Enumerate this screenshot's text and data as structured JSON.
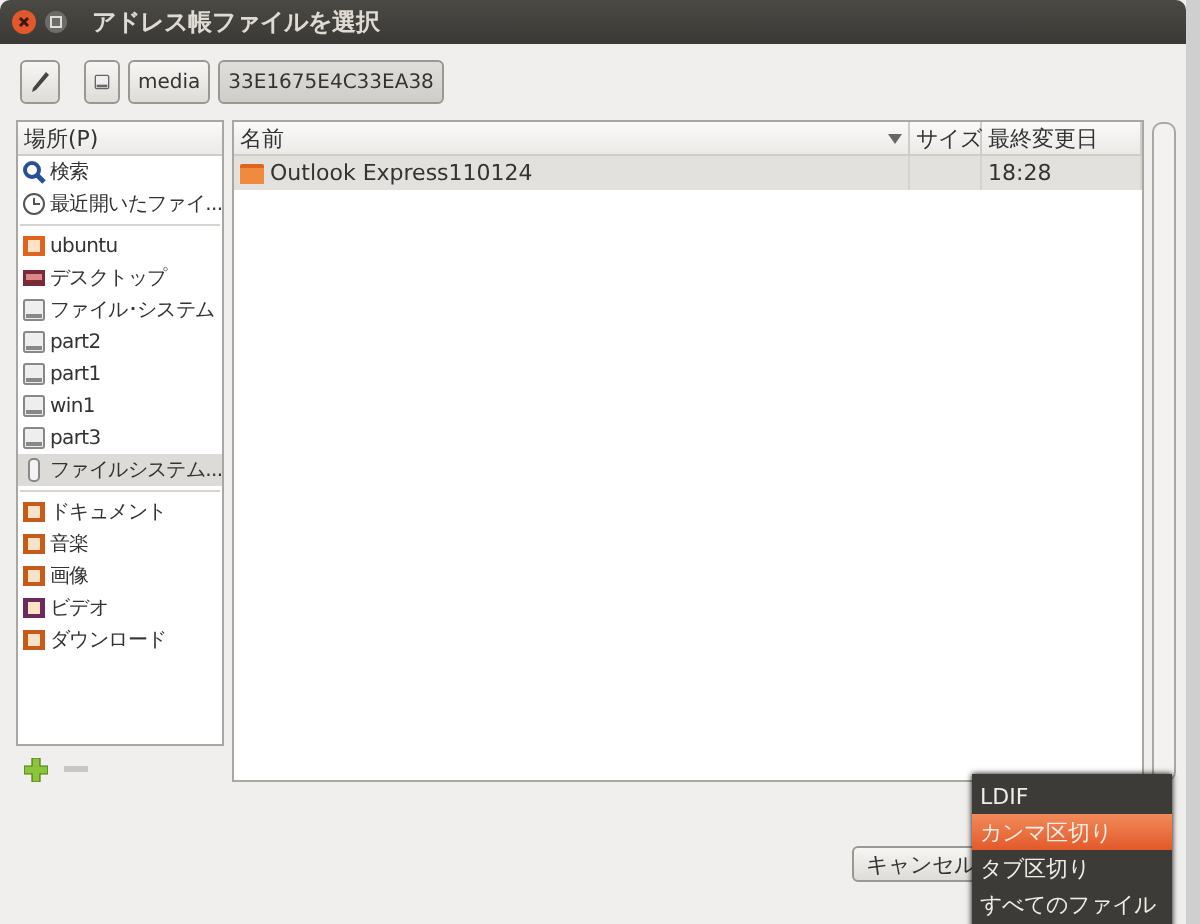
{
  "window": {
    "title": "アドレス帳ファイルを選択"
  },
  "path_bar": {
    "segments": [
      {
        "label": "media",
        "selected": false
      },
      {
        "label": "33E1675E4C33EA38",
        "selected": true
      }
    ]
  },
  "places": {
    "header": "場所(P)",
    "groups": [
      [
        {
          "kind": "search",
          "label": "検索",
          "selected": false
        },
        {
          "kind": "recent",
          "label": "最近開いたファイ...",
          "selected": false
        }
      ],
      [
        {
          "kind": "home",
          "label": "ubuntu",
          "selected": false
        },
        {
          "kind": "desktop",
          "label": "デスクトップ",
          "selected": false
        },
        {
          "kind": "drive",
          "label": "ファイル･システム",
          "selected": false
        },
        {
          "kind": "drive",
          "label": "part2",
          "selected": false
        },
        {
          "kind": "drive",
          "label": "part1",
          "selected": false
        },
        {
          "kind": "drive",
          "label": "win1",
          "selected": false
        },
        {
          "kind": "drive",
          "label": "part3",
          "selected": false
        },
        {
          "kind": "usb",
          "label": "ファイルシステム...",
          "selected": true
        }
      ],
      [
        {
          "kind": "documents",
          "label": "ドキュメント",
          "selected": false
        },
        {
          "kind": "music",
          "label": "音楽",
          "selected": false
        },
        {
          "kind": "pictures",
          "label": "画像",
          "selected": false
        },
        {
          "kind": "video",
          "label": "ビデオ",
          "selected": false
        },
        {
          "kind": "download",
          "label": "ダウンロード",
          "selected": false
        }
      ]
    ]
  },
  "files": {
    "columns": [
      "名前",
      "サイズ",
      "最終変更日"
    ],
    "rows": [
      {
        "name": "Outlook Express110124",
        "size": "",
        "modified": "18:28",
        "selected": true
      }
    ]
  },
  "cancel_button": "キャンセル",
  "filter_menu": [
    {
      "label": "LDIF",
      "selected": false
    },
    {
      "label": "カンマ区切り",
      "selected": true
    },
    {
      "label": "タブ区切り",
      "selected": false
    },
    {
      "label": "すべてのファイル",
      "selected": false
    }
  ]
}
